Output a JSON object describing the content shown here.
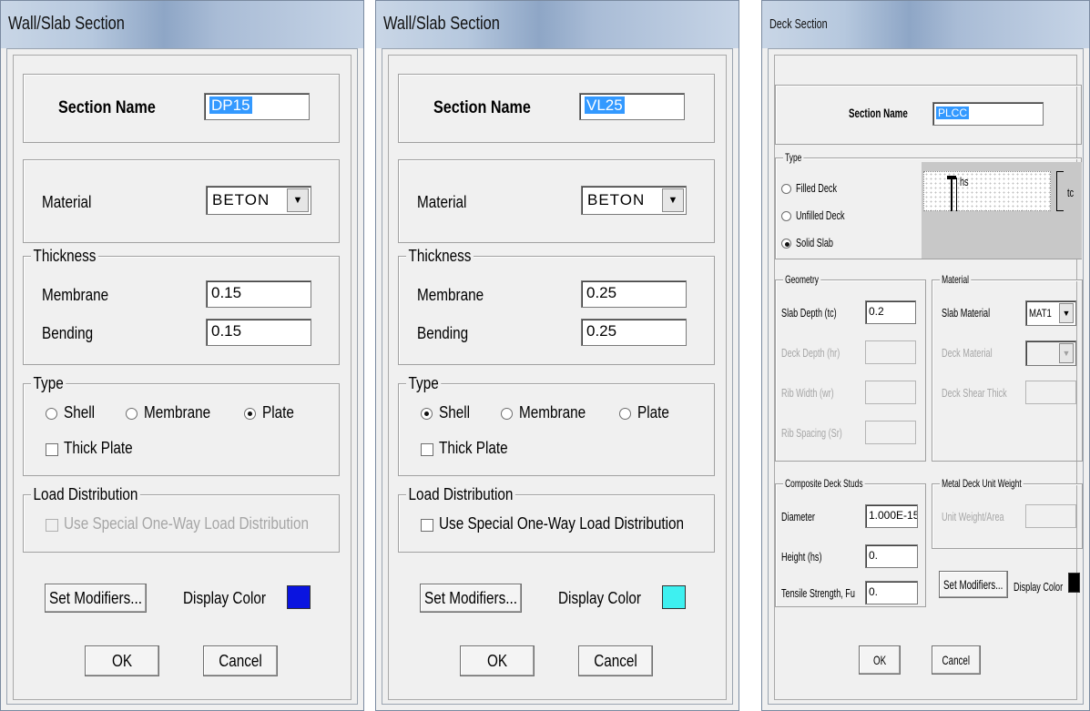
{
  "window1": {
    "title": "Wall/Slab Section",
    "section_name_label": "Section Name",
    "section_name_value": "DP15",
    "material_label": "Material",
    "material_value": "BETON",
    "thickness_legend": "Thickness",
    "membrane_label": "Membrane",
    "membrane_value": "0.15",
    "bending_label": "Bending",
    "bending_value": "0.15",
    "type_legend": "Type",
    "shell_label": "Shell",
    "membrane_type_label": "Membrane",
    "plate_label": "Plate",
    "selected_type": "Plate",
    "thick_plate_label": "Thick Plate",
    "load_dist_legend": "Load Distribution",
    "one_way_label": "Use Special One-Way Load Distribution",
    "set_modifiers_label": "Set Modifiers...",
    "display_color_label": "Display Color",
    "display_color": "#0a14e0",
    "ok_label": "OK",
    "cancel_label": "Cancel"
  },
  "window2": {
    "title": "Wall/Slab Section",
    "section_name_label": "Section Name",
    "section_name_value": "VL25",
    "material_label": "Material",
    "material_value": "BETON",
    "thickness_legend": "Thickness",
    "membrane_label": "Membrane",
    "membrane_value": "0.25",
    "bending_label": "Bending",
    "bending_value": "0.25",
    "type_legend": "Type",
    "shell_label": "Shell",
    "membrane_type_label": "Membrane",
    "plate_label": "Plate",
    "selected_type": "Shell",
    "thick_plate_label": "Thick Plate",
    "load_dist_legend": "Load Distribution",
    "one_way_label": "Use Special One-Way Load Distribution",
    "set_modifiers_label": "Set Modifiers...",
    "display_color_label": "Display Color",
    "display_color": "#3ef0f0",
    "ok_label": "OK",
    "cancel_label": "Cancel"
  },
  "window3": {
    "title": "Deck Section",
    "section_name_label": "Section Name",
    "section_name_value": "PLCC",
    "type_legend": "Type",
    "filled_deck_label": "Filled Deck",
    "unfilled_deck_label": "Unfilled Deck",
    "solid_slab_label": "Solid Slab",
    "selected_type": "Solid Slab",
    "diagram_hs": "hs",
    "diagram_tc": "tc",
    "geometry_legend": "Geometry",
    "slab_depth_label": "Slab Depth (tc)",
    "slab_depth_value": "0.2",
    "deck_depth_label": "Deck Depth (hr)",
    "rib_width_label": "Rib Width (wr)",
    "rib_spacing_label": "Rib Spacing (Sr)",
    "material_legend": "Material",
    "slab_material_label": "Slab Material",
    "slab_material_value": "MAT1",
    "deck_material_label": "Deck Material",
    "deck_shear_thick_label": "Deck Shear Thick",
    "studs_legend": "Composite Deck Studs",
    "diameter_label": "Diameter",
    "diameter_value": "1.000E-15",
    "height_label": "Height (hs)",
    "height_value": "0.",
    "tensile_label": "Tensile Strength, Fu",
    "tensile_value": "0.",
    "unit_weight_legend": "Metal Deck Unit Weight",
    "unit_weight_label": "Unit Weight/Area",
    "set_modifiers_label": "Set Modifiers...",
    "display_color_label": "Display Color",
    "display_color": "#000000",
    "ok_label": "OK",
    "cancel_label": "Cancel"
  }
}
